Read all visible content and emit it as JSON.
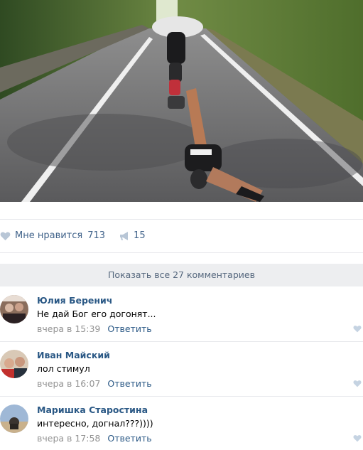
{
  "post": {
    "likes_label": "Мне нравится",
    "likes_count": "713",
    "shares_count": "15"
  },
  "show_all_label": "Показать все 27 комментариев",
  "comments": [
    {
      "author": "Юлия Беренич",
      "text": "Не дай Бог его догонят...",
      "time": "вчера в 15:39",
      "reply": "Ответить"
    },
    {
      "author": "Иван Майский",
      "text": "лол стимул",
      "time": "вчера в 16:07",
      "reply": "Ответить"
    },
    {
      "author": "Маришка Старостина",
      "text": "интересно, догнал???))))",
      "time": "вчера в 17:58",
      "reply": "Ответить"
    }
  ],
  "colors": {
    "link": "#2a5885",
    "like": "#42648b",
    "muted": "#939393",
    "band": "#edeef0"
  },
  "icons": [
    "heart-icon",
    "megaphone-icon"
  ]
}
